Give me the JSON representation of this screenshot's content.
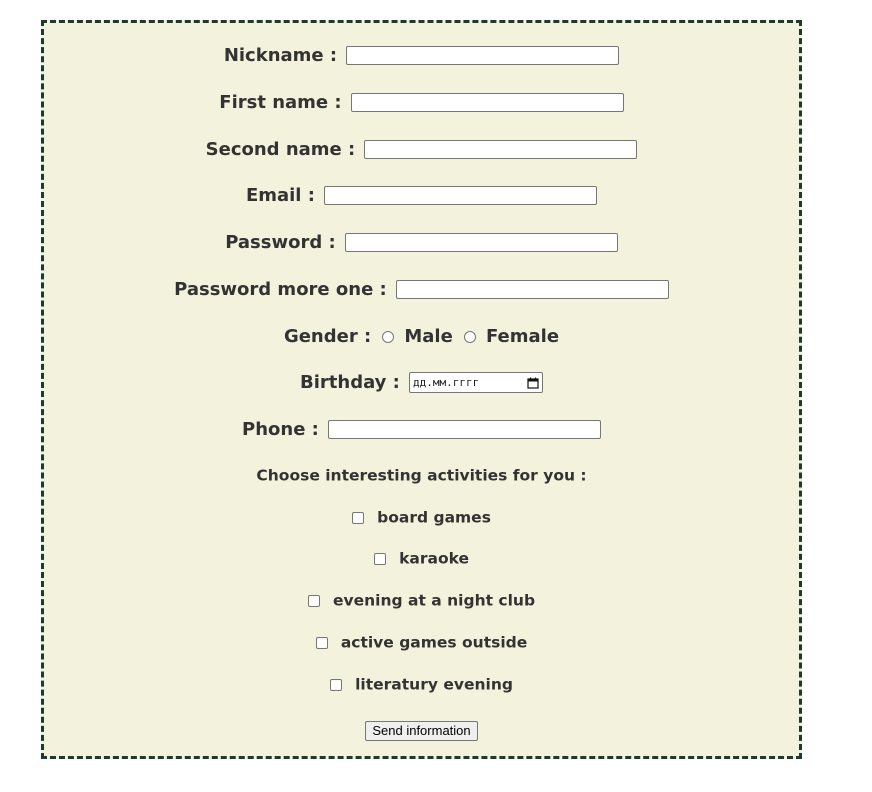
{
  "form": {
    "fields": {
      "nickname": {
        "label": "Nickname :",
        "value": ""
      },
      "first_name": {
        "label": "First name :",
        "value": ""
      },
      "second_name": {
        "label": "Second name :",
        "value": ""
      },
      "email": {
        "label": "Email :",
        "value": ""
      },
      "password": {
        "label": "Password :",
        "value": ""
      },
      "password_repeat": {
        "label": "Password more one :",
        "value": ""
      },
      "phone": {
        "label": "Phone :",
        "value": ""
      }
    },
    "gender": {
      "label": "Gender :",
      "options": [
        "Male",
        "Female"
      ]
    },
    "birthday": {
      "label": "Birthday :",
      "placeholder": "дд.мм.гггг"
    },
    "activities": {
      "heading": "Choose interesting activities for you :",
      "items": [
        "board games",
        "karaoke",
        "evening at a night club",
        "active games outside",
        "literatury evening"
      ]
    },
    "submit_label": "Send information"
  },
  "colors": {
    "form_background": "#f3f3dd",
    "form_border": "#1e3a2c",
    "label_text": "#333333"
  },
  "icons": {
    "date_picker": "calendar-icon"
  }
}
